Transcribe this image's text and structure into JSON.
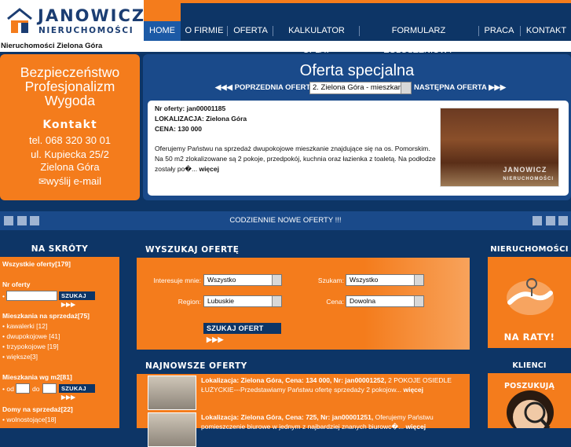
{
  "logo": {
    "line1": "JANOWICZ",
    "line2": "NIERUCHOMOŚCI"
  },
  "nav": {
    "items": [
      "HOME",
      "O FIRMIE",
      "OFERTA",
      "KALKULATOR OPŁAT",
      "FORMULARZ ZGŁOSZENIOWY",
      "PRACA",
      "KONTAKT"
    ],
    "active": "HOME"
  },
  "breadcrumb": "Nieruchomości Zielona Góra",
  "promo": {
    "slogans": [
      "Bezpieczeństwo",
      "Profesjonalizm",
      "Wygoda"
    ],
    "contact_title": "Kontakt",
    "phone": "tel. 068 320 30 01",
    "address1": "ul. Kupiecka 25/2",
    "address2": "Zielona Góra",
    "email": "wyślij e-mail"
  },
  "special": {
    "title": "Oferta specjalna",
    "prev": "POPRZEDNIA OFERTA",
    "next": "NASTĘPNA OFERTA",
    "select_value": "2. Zielona Góra - mieszkanie",
    "nr": "Nr oferty: jan00001185",
    "location": "LOKALIZACJA: Zielona Góra",
    "price": "CENA: 130 000",
    "description": "Oferujemy Państwu na sprzedaż dwupokojowe mieszkanie znajdujące się na os. Pomorskim. Na 50 m2 zlokalizowane są 2 pokoje, przedpokój, kuchnia oraz łazienka z toaletą. Na podłodze zostały po�...",
    "more": "więcej"
  },
  "strip_text": "CODZIENNIE NOWE OFERTY !!!",
  "skroty": {
    "title": "NA SKRÓTY",
    "all_offers": "Wszystkie oferty[179]",
    "nr_oferty": "Nr oferty",
    "search_btn": "SZUKAJ",
    "mieszkania_title": "Mieszkania na sprzedaż[75]",
    "mieszkania_items": [
      "kawalerki [12]",
      "dwupokojowe [41]",
      "trzypokojowe [19]",
      "większe[3]"
    ],
    "m2_title": "Mieszkania wg m2[81]",
    "od": "od",
    "do": "do",
    "domy_title": "Domy na sprzedaż[22]",
    "domy_items": [
      "wolnostojące[18]"
    ]
  },
  "search": {
    "title": "WYSZUKAJ OFERTĘ",
    "label_interesuje": "Interesuje mnie:",
    "value_interesuje": "Wszystko",
    "label_szukam": "Szukam:",
    "value_szukam": "Wszystko",
    "label_region": "Region:",
    "value_region": "Lubuskie",
    "label_cena": "Cena:",
    "value_cena": "Dowolna",
    "button": "SZUKAJ OFERT"
  },
  "newest": {
    "title": "NAJNOWSZE OFERTY",
    "items": [
      {
        "head": "Lokalizacja: Zielona Góra, Cena: 134 000, Nr: jan00001252,",
        "body": " 2 POKOJE OSIEDLE ŁUŻYCKIE---Przedstawiamy Państwu ofertę sprzedaży 2 pokojow...",
        "more": "więcej"
      },
      {
        "head": "Lokalizacja: Zielona Góra, Cena: 725, Nr: jan00001251,",
        "body": " Oferujemy Państwu pomieszczenie biurowe w jednym z najbardziej znanych biurowc�...",
        "more": "więcej"
      }
    ]
  },
  "ads": {
    "ad1_title": "NIERUCHOMOŚCI",
    "ad1_text": "NA RATY!",
    "ad2_title": "KLIENCI POSZUKUJĄ"
  },
  "colors": {
    "navy": "#0d3566",
    "orange": "#f47c1c",
    "blue": "#1a4a8a"
  }
}
